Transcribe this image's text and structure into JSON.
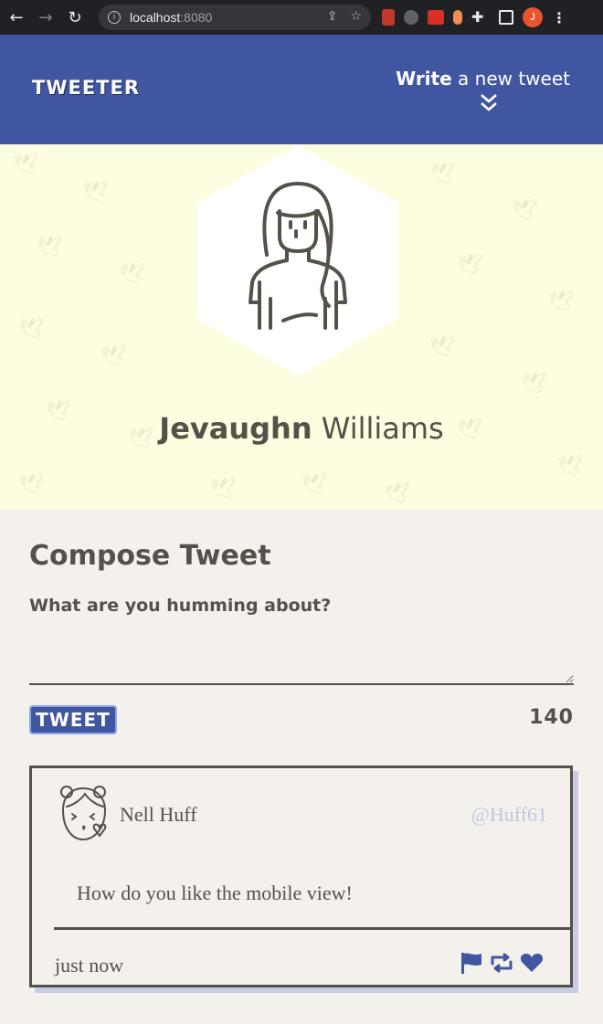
{
  "browser": {
    "url_host": "localhost",
    "url_port": ":8080",
    "profile_initial": "J"
  },
  "nav": {
    "brand": "TWEETER",
    "write_bold": "Write",
    "write_rest": "a new tweet"
  },
  "profile": {
    "first_name": "Jevaughn",
    "last_name": "Williams"
  },
  "compose": {
    "title": "Compose Tweet",
    "label": "What are you humming about?",
    "input_value": "",
    "button_label": "TWEET",
    "counter": "140"
  },
  "tweet": {
    "name": "Nell Huff",
    "handle": "@Huff61",
    "body": "How do you like the mobile view!",
    "time": "just now",
    "actions": [
      "flag-icon",
      "retweet-icon",
      "heart-icon"
    ]
  },
  "colors": {
    "nav_bg": "#4056a1",
    "header_bg": "#fdfde0",
    "page_bg": "#f4f1ec",
    "text": "#545149",
    "handle": "#c2c7de"
  }
}
